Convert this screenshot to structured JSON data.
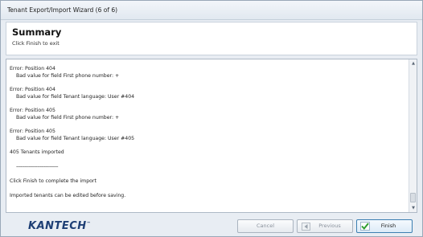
{
  "window": {
    "title": "Tenant Export/Import Wizard (6 of 6)"
  },
  "header": {
    "title": "Summary",
    "subtitle": "Click Finish to exit"
  },
  "log": {
    "entries": [
      {
        "line1": "Error: Position 404",
        "line2": "Bad value for field First phone number: +"
      },
      {
        "line1": "Error: Position 404",
        "line2": "Bad value for field Tenant language: User #404"
      },
      {
        "line1": "Error: Position 405",
        "line2": "Bad value for field First phone number: +"
      },
      {
        "line1": "Error: Position 405",
        "line2": "Bad value for field Tenant language: User #405"
      }
    ],
    "summary_line": "405 Tenants imported",
    "separator": "------------------------------",
    "instruction": "Click Finish to complete the import",
    "note": "Imported tenants can be edited before saving."
  },
  "footer": {
    "logo": "KANTECH",
    "cancel_label": "Cancel",
    "previous_label": "Previous",
    "finish_label": "Finish"
  },
  "icons": {
    "previous": "arrow-left-icon",
    "finish": "checkmark-icon",
    "scroll_up": "scroll-up-arrow-icon",
    "scroll_down": "scroll-down-arrow-icon"
  },
  "colors": {
    "logo": "#1e3f75",
    "finish_check": "#2f9e2f",
    "finish_border": "#3c7fb1"
  }
}
